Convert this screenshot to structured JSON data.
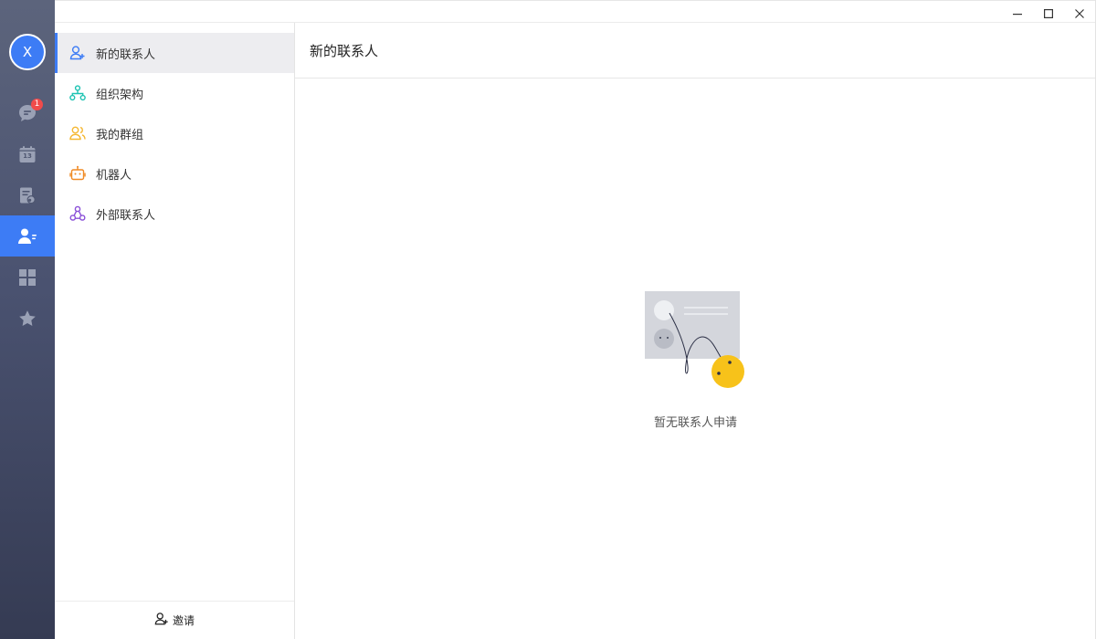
{
  "user": {
    "avatar_initial": "X"
  },
  "rail": {
    "items": [
      {
        "name": "messages",
        "icon": "chat-icon",
        "badge": "1",
        "active": false
      },
      {
        "name": "calendar",
        "icon": "calendar-icon",
        "calendar_day": "13",
        "active": false
      },
      {
        "name": "docs",
        "icon": "document-cloud-icon",
        "active": false
      },
      {
        "name": "contacts",
        "icon": "contacts-icon",
        "active": true
      },
      {
        "name": "workbench",
        "icon": "apps-grid-icon",
        "active": false
      },
      {
        "name": "favorites",
        "icon": "star-icon",
        "active": false
      }
    ]
  },
  "window_controls": [
    "minimize-icon",
    "maximize-icon",
    "close-icon"
  ],
  "contacts_nav": {
    "items": [
      {
        "label": "新的联系人",
        "icon": "add-user-icon",
        "color": "#3d7cf5",
        "active": true
      },
      {
        "label": "组织架构",
        "icon": "org-chart-icon",
        "color": "#1cc3b2",
        "active": false
      },
      {
        "label": "我的群组",
        "icon": "group-icon",
        "color": "#f5b731",
        "active": false
      },
      {
        "label": "机器人",
        "icon": "robot-icon",
        "color": "#f08a24",
        "active": false
      },
      {
        "label": "外部联系人",
        "icon": "external-contact-icon",
        "color": "#8a4fd8",
        "active": false
      }
    ],
    "invite_label": "邀请"
  },
  "main": {
    "title": "新的联系人",
    "empty_text": "暂无联系人申请"
  },
  "colors": {
    "accent": "#3d7cf5",
    "badge": "#f04b4b",
    "illustration_face": "#f7c21a"
  }
}
